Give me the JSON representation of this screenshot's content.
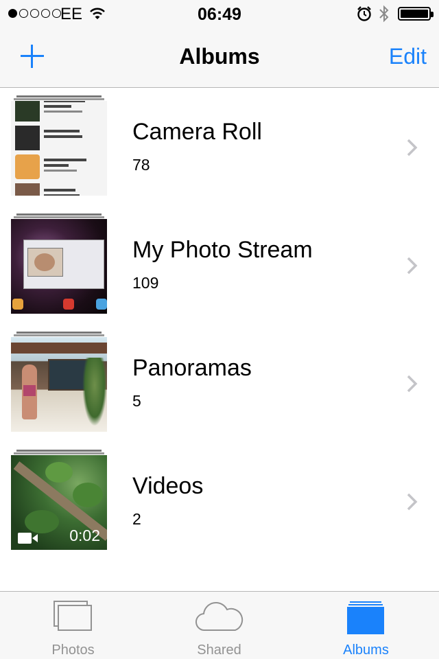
{
  "status_bar": {
    "carrier": "EE",
    "time": "06:49",
    "signal_bars_filled": 1,
    "signal_bars_total": 5
  },
  "nav": {
    "title": "Albums",
    "edit_label": "Edit",
    "add_icon": "plus-icon"
  },
  "albums": [
    {
      "name": "Camera Roll",
      "count": "78"
    },
    {
      "name": "My Photo Stream",
      "count": "109"
    },
    {
      "name": "Panoramas",
      "count": "5"
    },
    {
      "name": "Videos",
      "count": "2",
      "duration": "0:02"
    }
  ],
  "camera_roll_thumb": {
    "rows": [
      {
        "title": "RUBBER SOUL",
        "artist": "Beatles",
        "meta": "14 songs, 36 min"
      },
      {
        "title": "Sehnsucht",
        "artist": "Rammstein",
        "meta": ""
      },
      {
        "title": "Sex & Violins",
        "artist": "Rednex",
        "meta": "1 song, 4 min"
      },
      {
        "title": "Sgt. Pepper",
        "artist": "The Beatles",
        "meta": ""
      }
    ]
  },
  "tabs": [
    {
      "label": "Photos",
      "icon": "photos-icon",
      "active": false
    },
    {
      "label": "Shared",
      "icon": "cloud-icon",
      "active": false
    },
    {
      "label": "Albums",
      "icon": "albums-icon",
      "active": true
    }
  ],
  "colors": {
    "accent": "#1a82fb",
    "inactive": "#929292",
    "bar_background": "#f7f7f7"
  }
}
